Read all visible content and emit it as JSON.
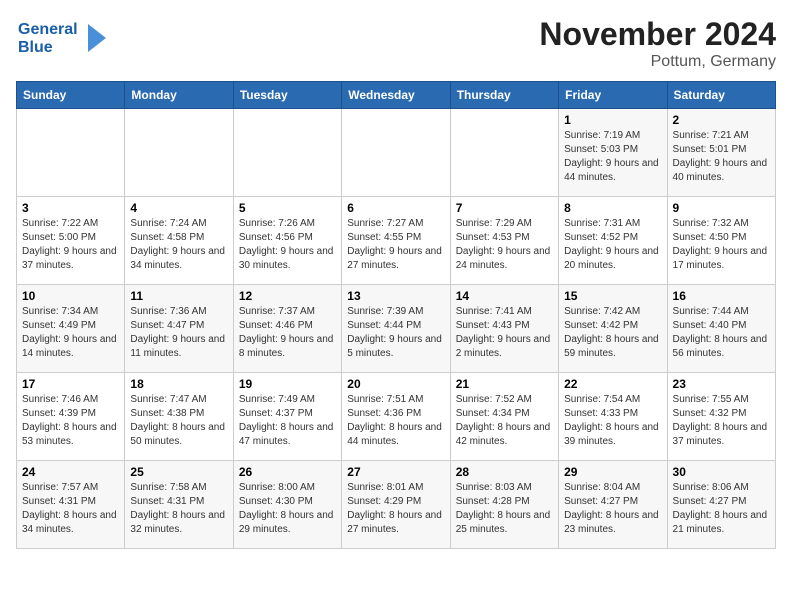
{
  "header": {
    "logo_line1": "General",
    "logo_line2": "Blue",
    "title": "November 2024",
    "subtitle": "Pottum, Germany"
  },
  "calendar": {
    "days_of_week": [
      "Sunday",
      "Monday",
      "Tuesday",
      "Wednesday",
      "Thursday",
      "Friday",
      "Saturday"
    ],
    "weeks": [
      [
        {
          "day": "",
          "info": ""
        },
        {
          "day": "",
          "info": ""
        },
        {
          "day": "",
          "info": ""
        },
        {
          "day": "",
          "info": ""
        },
        {
          "day": "",
          "info": ""
        },
        {
          "day": "1",
          "info": "Sunrise: 7:19 AM\nSunset: 5:03 PM\nDaylight: 9 hours and 44 minutes."
        },
        {
          "day": "2",
          "info": "Sunrise: 7:21 AM\nSunset: 5:01 PM\nDaylight: 9 hours and 40 minutes."
        }
      ],
      [
        {
          "day": "3",
          "info": "Sunrise: 7:22 AM\nSunset: 5:00 PM\nDaylight: 9 hours and 37 minutes."
        },
        {
          "day": "4",
          "info": "Sunrise: 7:24 AM\nSunset: 4:58 PM\nDaylight: 9 hours and 34 minutes."
        },
        {
          "day": "5",
          "info": "Sunrise: 7:26 AM\nSunset: 4:56 PM\nDaylight: 9 hours and 30 minutes."
        },
        {
          "day": "6",
          "info": "Sunrise: 7:27 AM\nSunset: 4:55 PM\nDaylight: 9 hours and 27 minutes."
        },
        {
          "day": "7",
          "info": "Sunrise: 7:29 AM\nSunset: 4:53 PM\nDaylight: 9 hours and 24 minutes."
        },
        {
          "day": "8",
          "info": "Sunrise: 7:31 AM\nSunset: 4:52 PM\nDaylight: 9 hours and 20 minutes."
        },
        {
          "day": "9",
          "info": "Sunrise: 7:32 AM\nSunset: 4:50 PM\nDaylight: 9 hours and 17 minutes."
        }
      ],
      [
        {
          "day": "10",
          "info": "Sunrise: 7:34 AM\nSunset: 4:49 PM\nDaylight: 9 hours and 14 minutes."
        },
        {
          "day": "11",
          "info": "Sunrise: 7:36 AM\nSunset: 4:47 PM\nDaylight: 9 hours and 11 minutes."
        },
        {
          "day": "12",
          "info": "Sunrise: 7:37 AM\nSunset: 4:46 PM\nDaylight: 9 hours and 8 minutes."
        },
        {
          "day": "13",
          "info": "Sunrise: 7:39 AM\nSunset: 4:44 PM\nDaylight: 9 hours and 5 minutes."
        },
        {
          "day": "14",
          "info": "Sunrise: 7:41 AM\nSunset: 4:43 PM\nDaylight: 9 hours and 2 minutes."
        },
        {
          "day": "15",
          "info": "Sunrise: 7:42 AM\nSunset: 4:42 PM\nDaylight: 8 hours and 59 minutes."
        },
        {
          "day": "16",
          "info": "Sunrise: 7:44 AM\nSunset: 4:40 PM\nDaylight: 8 hours and 56 minutes."
        }
      ],
      [
        {
          "day": "17",
          "info": "Sunrise: 7:46 AM\nSunset: 4:39 PM\nDaylight: 8 hours and 53 minutes."
        },
        {
          "day": "18",
          "info": "Sunrise: 7:47 AM\nSunset: 4:38 PM\nDaylight: 8 hours and 50 minutes."
        },
        {
          "day": "19",
          "info": "Sunrise: 7:49 AM\nSunset: 4:37 PM\nDaylight: 8 hours and 47 minutes."
        },
        {
          "day": "20",
          "info": "Sunrise: 7:51 AM\nSunset: 4:36 PM\nDaylight: 8 hours and 44 minutes."
        },
        {
          "day": "21",
          "info": "Sunrise: 7:52 AM\nSunset: 4:34 PM\nDaylight: 8 hours and 42 minutes."
        },
        {
          "day": "22",
          "info": "Sunrise: 7:54 AM\nSunset: 4:33 PM\nDaylight: 8 hours and 39 minutes."
        },
        {
          "day": "23",
          "info": "Sunrise: 7:55 AM\nSunset: 4:32 PM\nDaylight: 8 hours and 37 minutes."
        }
      ],
      [
        {
          "day": "24",
          "info": "Sunrise: 7:57 AM\nSunset: 4:31 PM\nDaylight: 8 hours and 34 minutes."
        },
        {
          "day": "25",
          "info": "Sunrise: 7:58 AM\nSunset: 4:31 PM\nDaylight: 8 hours and 32 minutes."
        },
        {
          "day": "26",
          "info": "Sunrise: 8:00 AM\nSunset: 4:30 PM\nDaylight: 8 hours and 29 minutes."
        },
        {
          "day": "27",
          "info": "Sunrise: 8:01 AM\nSunset: 4:29 PM\nDaylight: 8 hours and 27 minutes."
        },
        {
          "day": "28",
          "info": "Sunrise: 8:03 AM\nSunset: 4:28 PM\nDaylight: 8 hours and 25 minutes."
        },
        {
          "day": "29",
          "info": "Sunrise: 8:04 AM\nSunset: 4:27 PM\nDaylight: 8 hours and 23 minutes."
        },
        {
          "day": "30",
          "info": "Sunrise: 8:06 AM\nSunset: 4:27 PM\nDaylight: 8 hours and 21 minutes."
        }
      ]
    ]
  }
}
